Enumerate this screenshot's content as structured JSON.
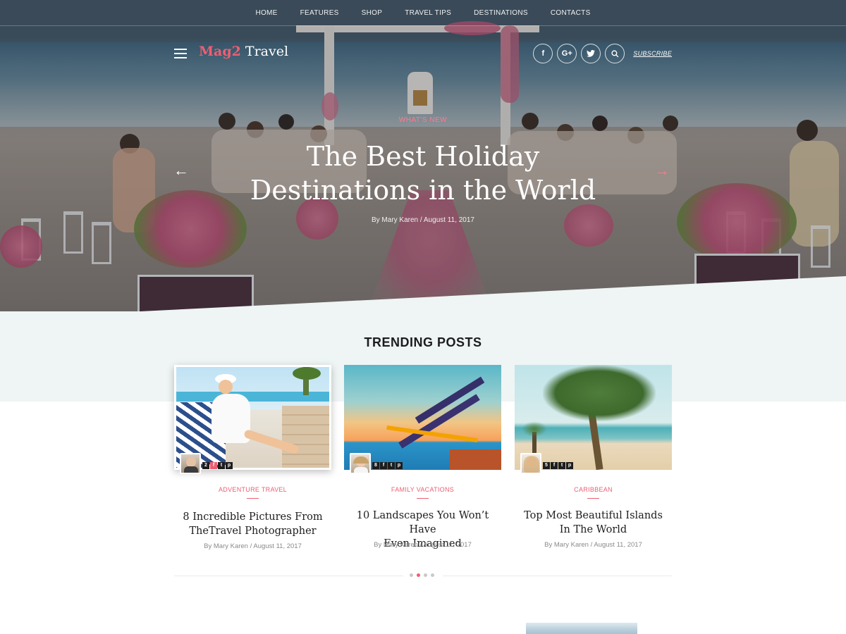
{
  "nav": {
    "items": [
      "HOME",
      "FEATURES",
      "SHOP",
      "TRAVEL TIPS",
      "DESTINATIONS",
      "CONTACTS"
    ]
  },
  "brand": {
    "part1": "Mag2",
    "part2": " Travel",
    "subscribe": "SUBSCRIBE",
    "social_icons": [
      "facebook-icon",
      "google-plus-icon",
      "twitter-icon",
      "search-icon"
    ]
  },
  "hero": {
    "kicker": "WHAT'S NEW",
    "title_line1": "The Best Holiday",
    "title_line2": "Destinations in the World",
    "meta": "By Mary Karen / August 11, 2017",
    "prev_arrow": "←",
    "next_arrow": "→"
  },
  "trending": {
    "heading": "TRENDING POSTS",
    "posts": [
      {
        "category": "ADVENTURE TRAVEL",
        "title_line1": "8 Incredible Pictures From",
        "title_line2": "TheTravel Photographer",
        "meta": "By Mary Karen / August 11, 2017",
        "count": "2",
        "share_icons": [
          "f",
          "t",
          "p"
        ]
      },
      {
        "category": "FAMILY VACATIONS",
        "title_line1": "10 Landscapes You Won’t Have",
        "title_line2": "Even Imagined",
        "meta": "By Mary Karen / August 11, 2017",
        "count": "8",
        "share_icons": [
          "f",
          "t",
          "p"
        ]
      },
      {
        "category": "CARIBBEAN",
        "title_line1": "Top Most Beautiful Islands",
        "title_line2": "In The World",
        "meta": "By Mary Karen / August 11, 2017",
        "count": "5",
        "share_icons": [
          "f",
          "t",
          "p"
        ]
      }
    ],
    "pagination": {
      "pages": 4,
      "active": 2
    }
  },
  "colors": {
    "accent": "#ec5f72",
    "trend_bg": "#eef5f4",
    "text_dark": "#1d1d1d"
  }
}
